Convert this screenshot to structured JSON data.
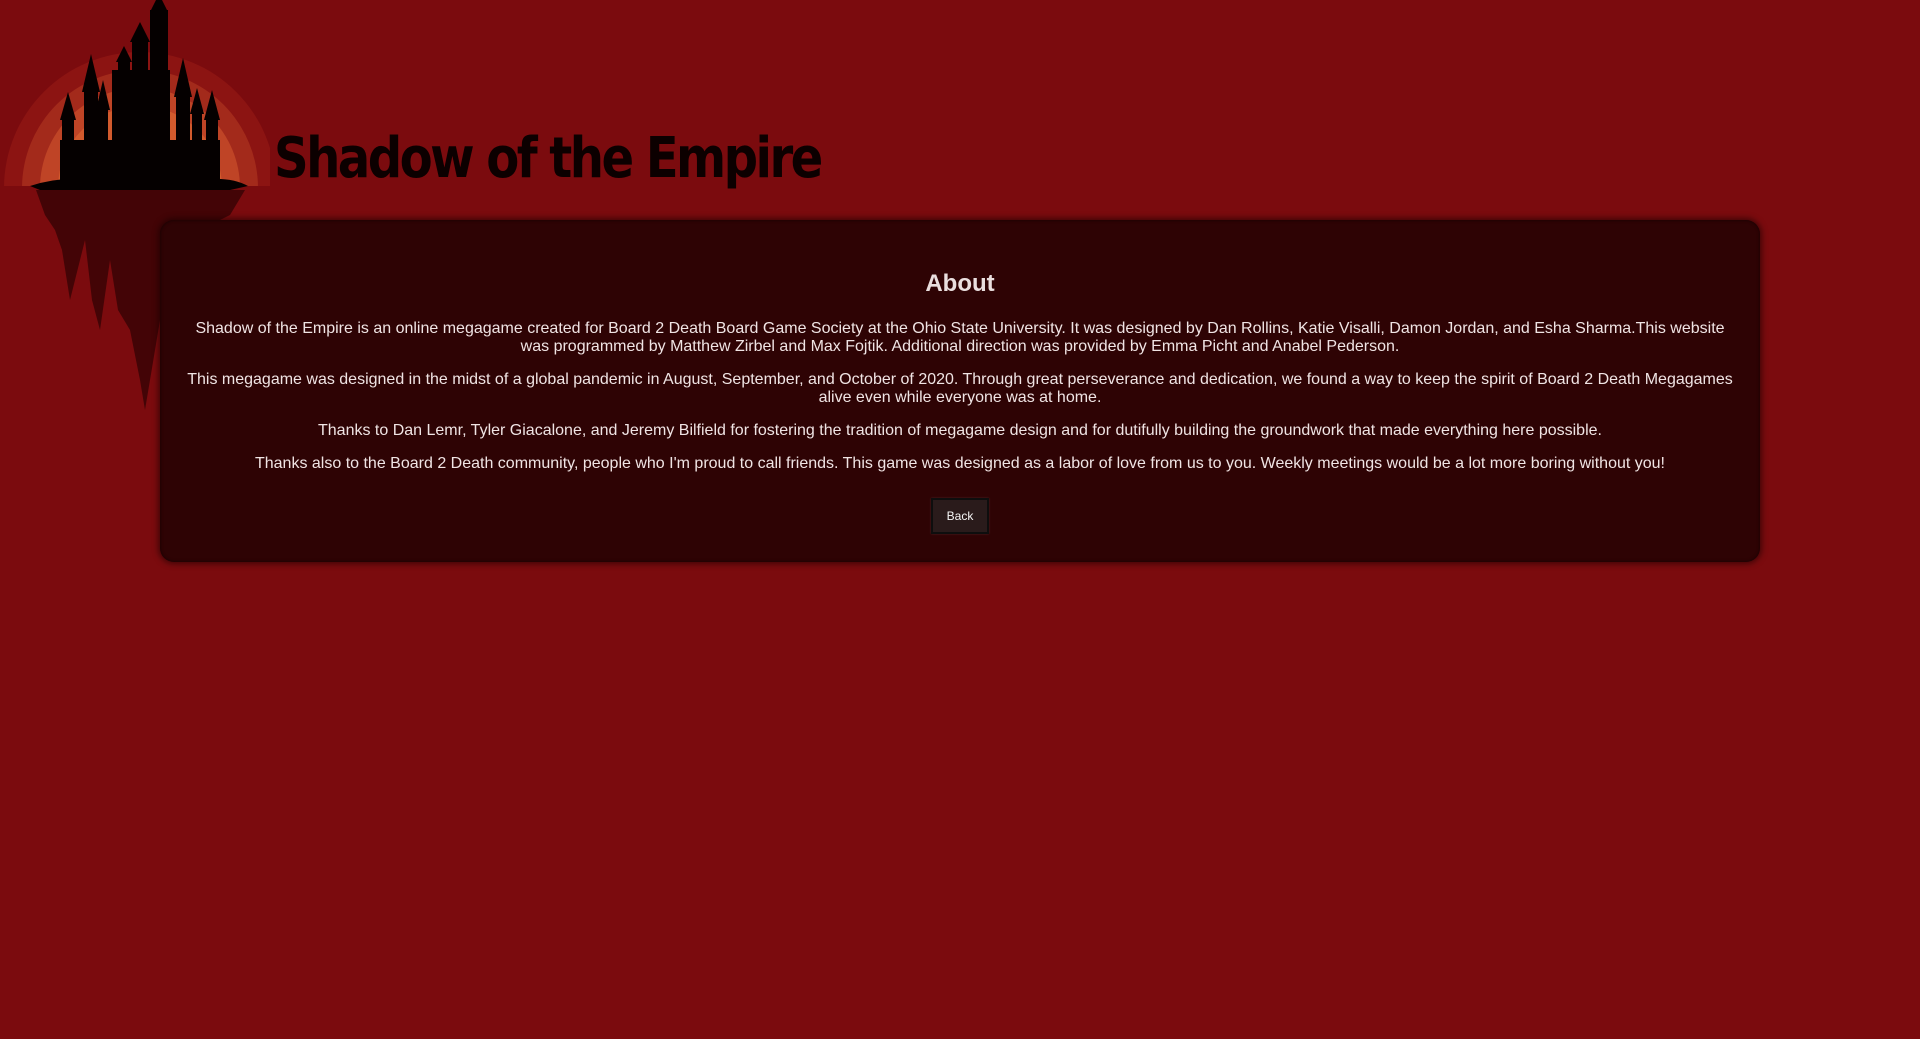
{
  "header": {
    "title": "Shadow of the Empire",
    "logo_icon": "castle-logo-icon"
  },
  "about": {
    "heading": "About",
    "paragraphs": [
      "Shadow of the Empire is an online megagame created for Board 2 Death Board Game Society at the Ohio State University. It was designed by Dan Rollins, Katie Visalli, Damon Jordan, and Esha Sharma.This website was programmed by Matthew Zirbel and Max Fojtik. Additional direction was provided by Emma Picht and Anabel Pederson.",
      "This megagame was designed in the midst of a global pandemic in August, September, and October of 2020. Through great perseverance and dedication, we found a way to keep the spirit of Board 2 Death Megagames alive even while everyone was at home.",
      "Thanks to Dan Lemr, Tyler Giacalone, and Jeremy Bilfield for fostering the tradition of megagame design and for dutifully building the groundwork that made everything here possible.",
      "Thanks also to the Board 2 Death community, people who I'm proud to call friends. This game was designed as a labor of love from us to you. Weekly meetings would be a lot more boring without you!"
    ],
    "back_label": "Back"
  },
  "colors": {
    "background": "#7b0b0e",
    "panel": "#2e0304",
    "title": "#0c0000"
  }
}
